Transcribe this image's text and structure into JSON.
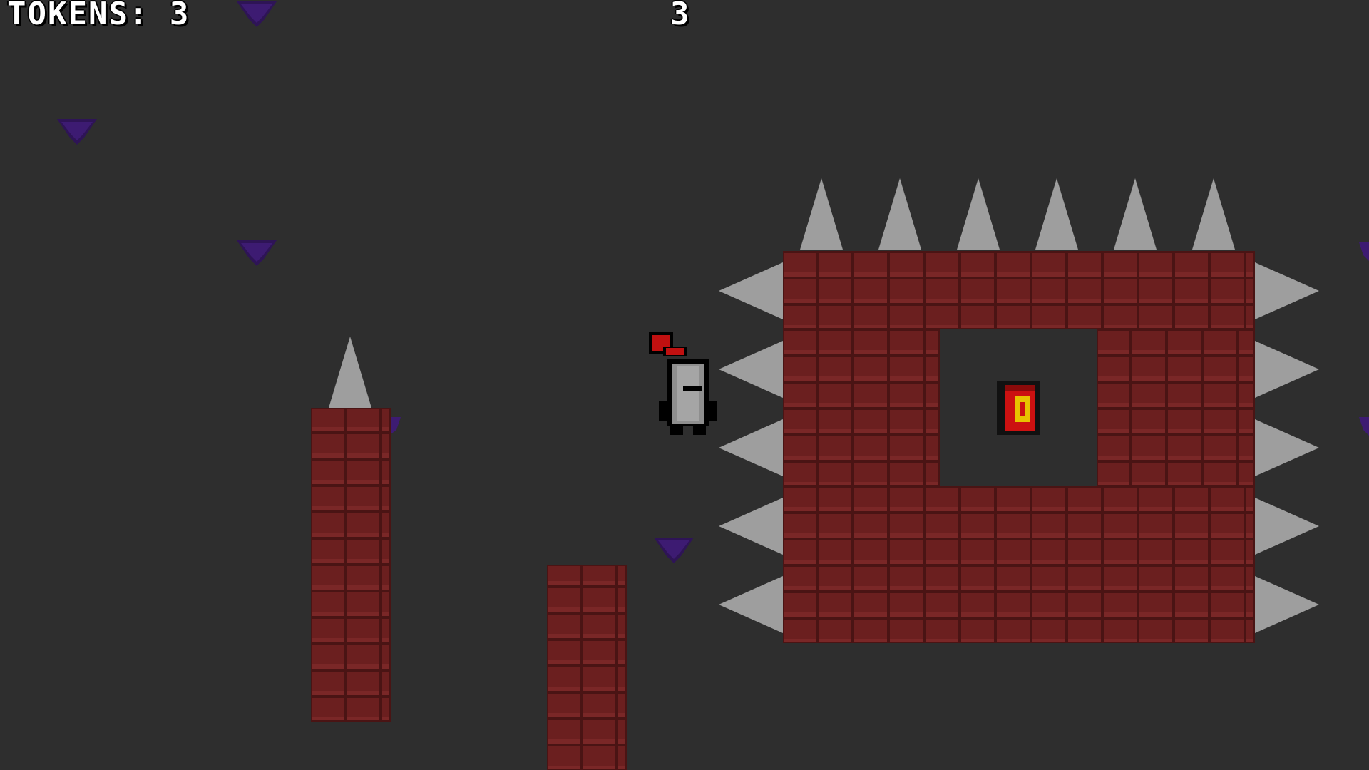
{
  "hud": {
    "tokens_label": "TOKENS: 3",
    "counter": "3"
  },
  "colors": {
    "background": "#494949",
    "brick": "#6b1f1f",
    "spike": "#9e9e9e",
    "token": "#3b1a66",
    "knight_plume": "#c01010",
    "chest_red": "#cc1111",
    "chest_gold": "#e8c200"
  },
  "sprites": {
    "player": "knight-icon",
    "collectible": "purple-token-icon",
    "goal": "treasure-chest-icon",
    "hazard": "spike-icon"
  }
}
